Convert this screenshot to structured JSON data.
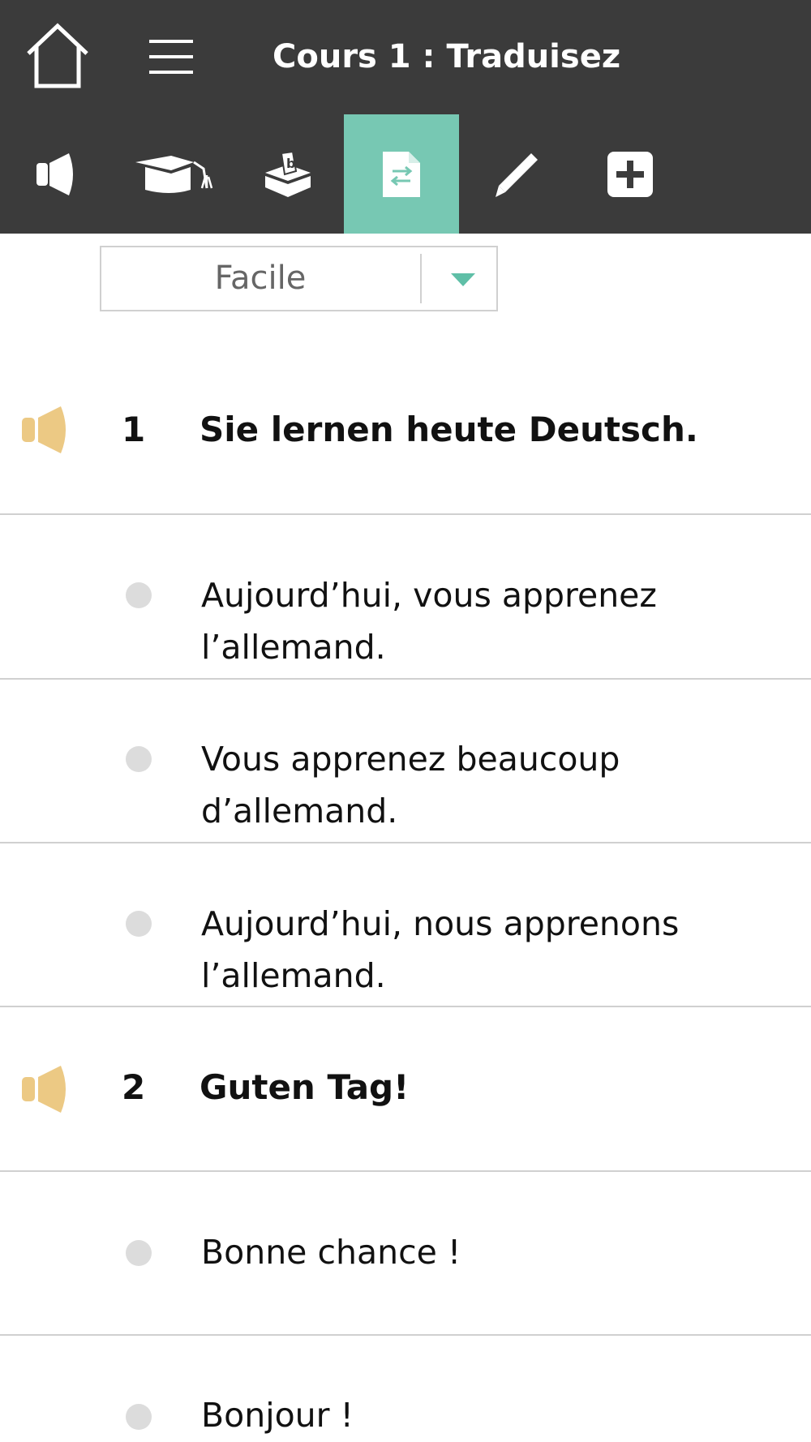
{
  "header": {
    "title": "Cours 1 : Traduisez",
    "home_icon": "home-icon",
    "menu_icon": "hamburger-menu-icon",
    "background": "#3b3b3b"
  },
  "tabs": [
    {
      "icon": "speaker-icon",
      "active": false
    },
    {
      "icon": "graduation-cap-icon",
      "active": false
    },
    {
      "icon": "ballot-box-icon",
      "active": false
    },
    {
      "icon": "translate-document-icon",
      "active": true
    },
    {
      "icon": "pencil-icon",
      "active": false
    },
    {
      "icon": "plus-square-icon",
      "active": false
    }
  ],
  "accent_color": "#77c8b3",
  "speaker_color": "#ecc984",
  "difficulty": {
    "selected": "Facile"
  },
  "exercises": [
    {
      "number": "1",
      "sentence": "Sie lernen heute Deutsch.",
      "options": [
        "Aujourd’hui, vous apprenez l’allemand.",
        "Vous apprenez beaucoup d’allemand.",
        "Aujourd’hui, nous apprenons l’allemand."
      ]
    },
    {
      "number": "2",
      "sentence": "Guten Tag!",
      "options": [
        "Bonne chance !",
        "Bonjour !"
      ]
    }
  ]
}
